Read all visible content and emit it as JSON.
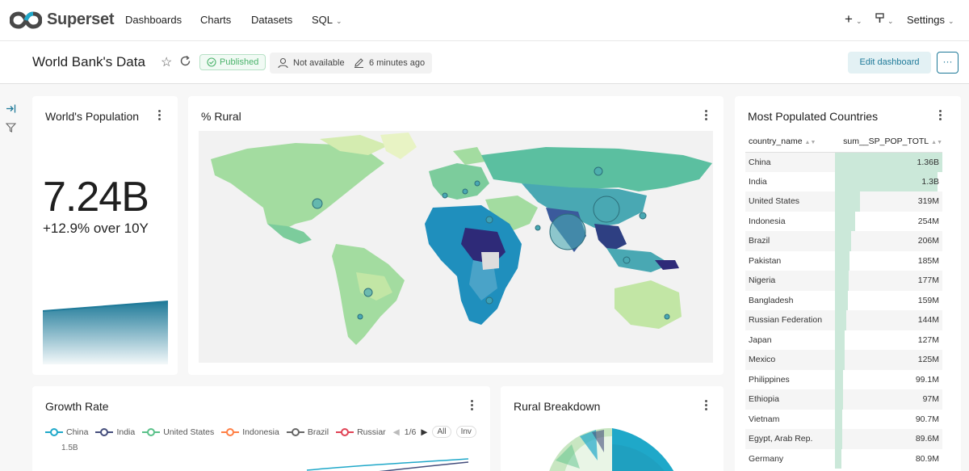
{
  "app": {
    "name": "Superset"
  },
  "nav": {
    "dashboards": "Dashboards",
    "charts": "Charts",
    "datasets": "Datasets",
    "sql": "SQL",
    "settings": "Settings",
    "add_icon": "+",
    "plus-icon": "plus-icon"
  },
  "header": {
    "title": "World Bank's Data",
    "status": "Published",
    "owner": "Not available",
    "modified": "6 minutes ago",
    "edit_button": "Edit dashboard",
    "more_button": "···"
  },
  "cards": {
    "population": {
      "title": "World's Population",
      "value": "7.24B",
      "delta": "+12.9% over 10Y"
    },
    "rural": {
      "title": "% Rural"
    },
    "countries": {
      "title": "Most Populated Countries"
    },
    "growth": {
      "title": "Growth Rate",
      "axis_label": "1.5B",
      "page": "1/6",
      "all": "All",
      "inv": "Inv"
    },
    "breakdown": {
      "title": "Rural Breakdown"
    }
  },
  "table": {
    "columns": [
      "country_name",
      "sum__SP_POP_TOTL"
    ],
    "rows": [
      {
        "name": "China",
        "value": "1.36B",
        "pct": 1.0
      },
      {
        "name": "India",
        "value": "1.3B",
        "pct": 0.955
      },
      {
        "name": "United States",
        "value": "319M",
        "pct": 0.234
      },
      {
        "name": "Indonesia",
        "value": "254M",
        "pct": 0.187
      },
      {
        "name": "Brazil",
        "value": "206M",
        "pct": 0.151
      },
      {
        "name": "Pakistan",
        "value": "185M",
        "pct": 0.136
      },
      {
        "name": "Nigeria",
        "value": "177M",
        "pct": 0.13
      },
      {
        "name": "Bangladesh",
        "value": "159M",
        "pct": 0.117
      },
      {
        "name": "Russian Federation",
        "value": "144M",
        "pct": 0.106
      },
      {
        "name": "Japan",
        "value": "127M",
        "pct": 0.093
      },
      {
        "name": "Mexico",
        "value": "125M",
        "pct": 0.092
      },
      {
        "name": "Philippines",
        "value": "99.1M",
        "pct": 0.073
      },
      {
        "name": "Ethiopia",
        "value": "97M",
        "pct": 0.071
      },
      {
        "name": "Vietnam",
        "value": "90.7M",
        "pct": 0.067
      },
      {
        "name": "Egypt, Arab Rep.",
        "value": "89.6M",
        "pct": 0.066
      },
      {
        "name": "Germany",
        "value": "80.9M",
        "pct": 0.059
      }
    ]
  },
  "legend": [
    {
      "name": "China",
      "color": "#1fa8c9"
    },
    {
      "name": "India",
      "color": "#454e7c"
    },
    {
      "name": "United States",
      "color": "#5ac189"
    },
    {
      "name": "Indonesia",
      "color": "#ff7f44"
    },
    {
      "name": "Brazil",
      "color": "#666666"
    },
    {
      "name": "Russiar",
      "color": "#e04355"
    }
  ],
  "colors": {
    "accent": "#1f7a99",
    "published": "#4bb36b",
    "bar": "#cbe8d9"
  }
}
